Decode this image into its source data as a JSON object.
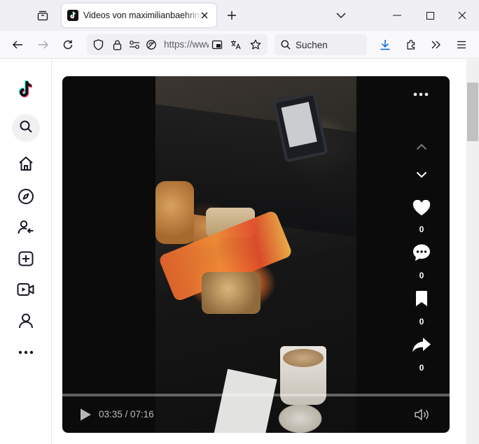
{
  "browser": {
    "tab": {
      "title": "Videos von maximilianbaehring",
      "favicon": "tiktok-icon"
    },
    "url": "https://www.",
    "search_placeholder": "Suchen",
    "icons": [
      "tab-list-icon",
      "close-icon",
      "plus-icon",
      "chevron-down-icon",
      "minimize-icon",
      "maximize-icon",
      "close-window-icon",
      "back-icon",
      "forward-icon",
      "reload-icon",
      "shield-icon",
      "lock-icon",
      "permissions-icon",
      "tracking-off-icon",
      "reader-view-icon",
      "translate-icon",
      "star-icon",
      "search-icon",
      "download-icon",
      "extensions-icon",
      "overflow-icon",
      "menu-icon"
    ]
  },
  "sidebar": {
    "items": [
      "tiktok-logo",
      "search",
      "home",
      "explore",
      "following",
      "upload",
      "live",
      "profile",
      "more"
    ]
  },
  "video": {
    "counts": {
      "likes": "0",
      "comments": "0",
      "bookmarks": "0",
      "shares": "0"
    },
    "time": "03:35 / 07:16",
    "progress": 0.0
  },
  "colors": {
    "tiktok_cyan": "#25f4ee",
    "tiktok_red": "#fe2c55",
    "download_blue": "#0061e0"
  }
}
